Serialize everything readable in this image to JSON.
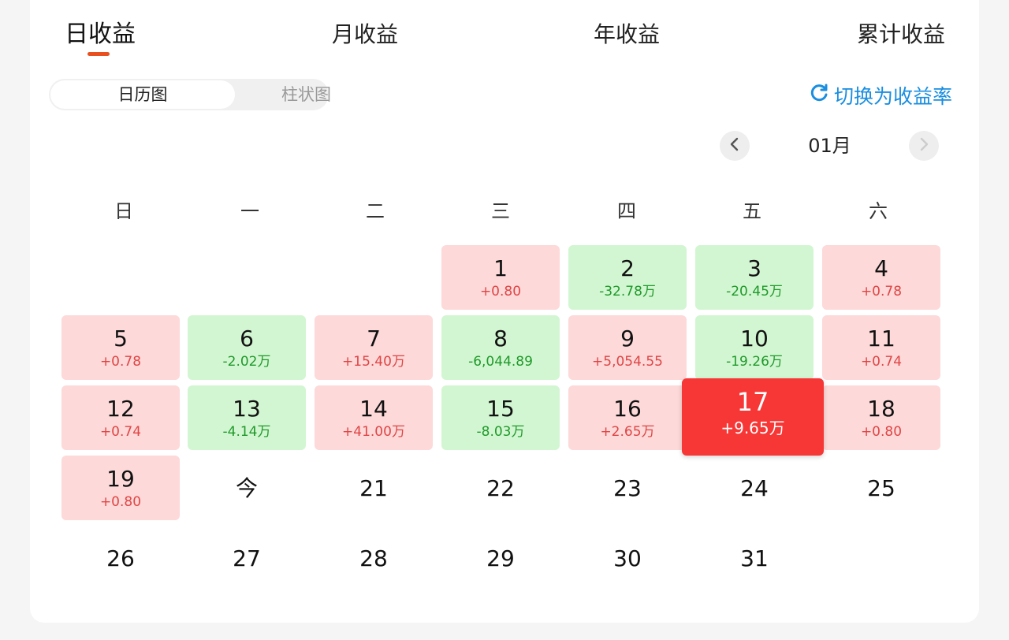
{
  "tabs": [
    "日收益",
    "月收益",
    "年收益",
    "累计收益"
  ],
  "view_toggle": {
    "calendar": "日历图",
    "bar": "柱状图"
  },
  "switch_label": "切换为收益率",
  "month": "01月",
  "weekdays": [
    "日",
    "一",
    "二",
    "三",
    "四",
    "五",
    "六"
  ],
  "colors": {
    "gain": "#fdd9d9",
    "loss": "#d3f6d2",
    "selected": "#f73636",
    "accent": "#1a8ee0",
    "underline": "#e8501f"
  },
  "days": [
    {
      "day": "1",
      "value": "+0.80",
      "trend": "up"
    },
    {
      "day": "2",
      "value": "-32.78万",
      "trend": "down"
    },
    {
      "day": "3",
      "value": "-20.45万",
      "trend": "down"
    },
    {
      "day": "4",
      "value": "+0.78",
      "trend": "up"
    },
    {
      "day": "5",
      "value": "+0.78",
      "trend": "up"
    },
    {
      "day": "6",
      "value": "-2.02万",
      "trend": "down"
    },
    {
      "day": "7",
      "value": "+15.40万",
      "trend": "up"
    },
    {
      "day": "8",
      "value": "-6,044.89",
      "trend": "down"
    },
    {
      "day": "9",
      "value": "+5,054.55",
      "trend": "up"
    },
    {
      "day": "10",
      "value": "-19.26万",
      "trend": "down"
    },
    {
      "day": "11",
      "value": "+0.74",
      "trend": "up"
    },
    {
      "day": "12",
      "value": "+0.74",
      "trend": "up"
    },
    {
      "day": "13",
      "value": "-4.14万",
      "trend": "down"
    },
    {
      "day": "14",
      "value": "+41.00万",
      "trend": "up"
    },
    {
      "day": "15",
      "value": "-8.03万",
      "trend": "down"
    },
    {
      "day": "16",
      "value": "+2.65万",
      "trend": "up"
    },
    {
      "day": "17",
      "value": "+9.65万",
      "trend": "selected"
    },
    {
      "day": "18",
      "value": "+0.80",
      "trend": "up"
    },
    {
      "day": "19",
      "value": "+0.80",
      "trend": "up"
    },
    {
      "day": "今",
      "value": "",
      "trend": "none"
    },
    {
      "day": "21",
      "value": "",
      "trend": "none"
    },
    {
      "day": "22",
      "value": "",
      "trend": "none"
    },
    {
      "day": "23",
      "value": "",
      "trend": "none"
    },
    {
      "day": "24",
      "value": "",
      "trend": "none"
    },
    {
      "day": "25",
      "value": "",
      "trend": "none"
    },
    {
      "day": "26",
      "value": "",
      "trend": "none"
    },
    {
      "day": "27",
      "value": "",
      "trend": "none"
    },
    {
      "day": "28",
      "value": "",
      "trend": "none"
    },
    {
      "day": "29",
      "value": "",
      "trend": "none"
    },
    {
      "day": "30",
      "value": "",
      "trend": "none"
    },
    {
      "day": "31",
      "value": "",
      "trend": "none"
    }
  ]
}
